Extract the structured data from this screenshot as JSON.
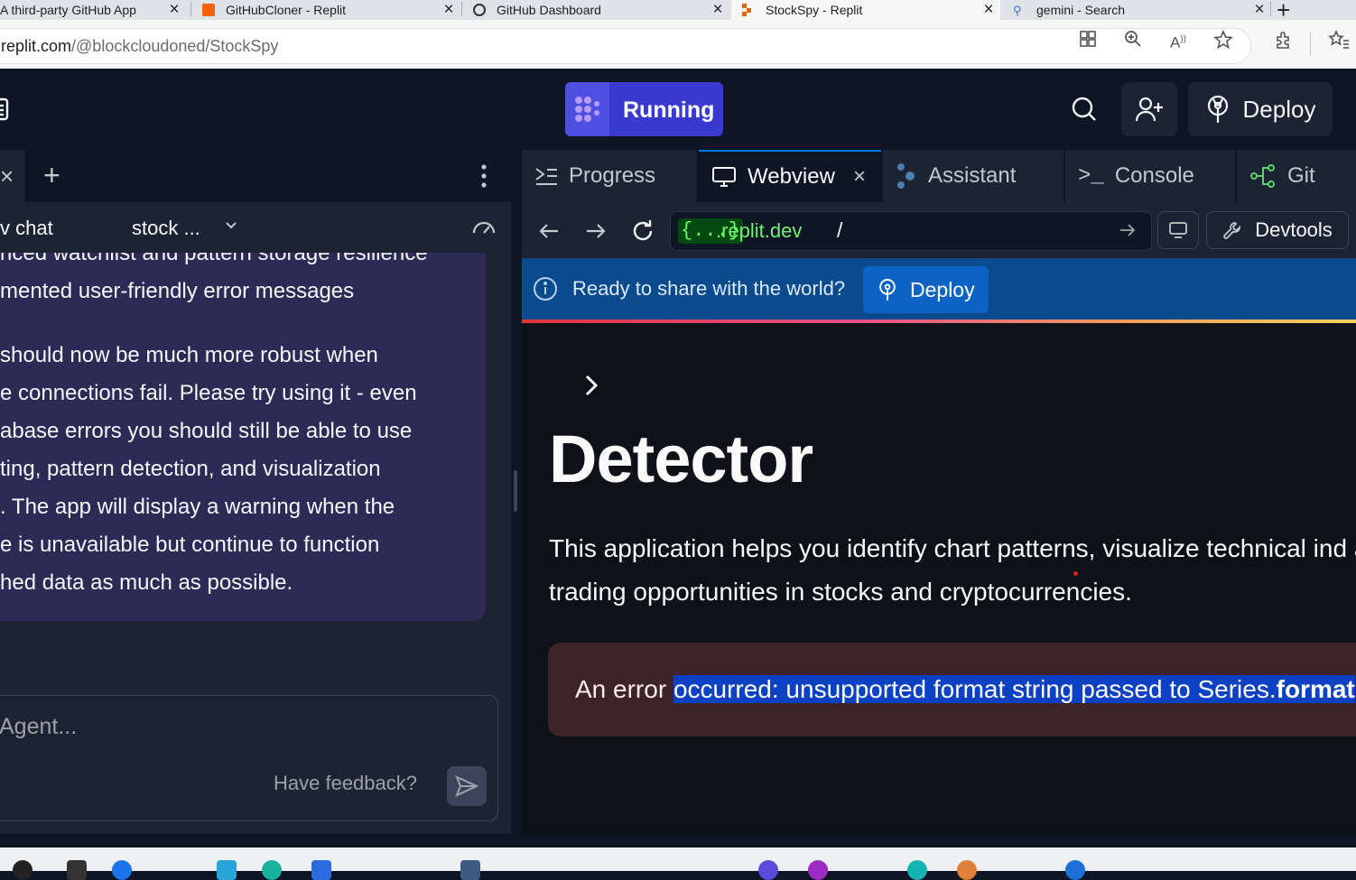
{
  "browser": {
    "tabs": [
      {
        "title": "A third-party GitHub App",
        "prefix": ")]",
        "active": false
      },
      {
        "title": "GitHubCloner - Replit",
        "active": false
      },
      {
        "title": "GitHub Dashboard",
        "active": false
      },
      {
        "title": "StockSpy - Replit",
        "active": true
      },
      {
        "title": "gemini - Search",
        "active": false
      }
    ],
    "url_host": "replit.com",
    "url_path": "/@blockcloudoned/StockSpy"
  },
  "header": {
    "run_label": "Running",
    "deploy_label": "Deploy",
    "colors": {
      "run": "#3b3ad0",
      "bg": "#0e1525"
    }
  },
  "left": {
    "chat_title": "v chat",
    "session": "stock ...",
    "message_lines": [
      "nced watchlist and pattern storage resilience",
      "mented user-friendly error messages",
      "",
      "should now be much more robust when",
      "e connections fail. Please try using it - even",
      "abase errors you should still be able to use",
      "ting, pattern detection, and visualization",
      ". The app will display a warning when the",
      "e is unavailable but continue to function",
      "hed data as much as possible."
    ],
    "input_placeholder": "Agent...",
    "feedback": "Have feedback?"
  },
  "right": {
    "tabs": [
      {
        "label": "Progress",
        "icon": "progress-icon"
      },
      {
        "label": "Webview",
        "icon": "monitor-icon",
        "active": true
      },
      {
        "label": "Assistant",
        "icon": "assistant-icon"
      },
      {
        "label": "Console",
        "icon": "console-icon"
      },
      {
        "label": "Git",
        "icon": "git-icon"
      }
    ],
    "webview": {
      "url_tag": "{...}",
      "url_host": ".replit.dev",
      "url_path": "/",
      "devtools": "Devtools"
    },
    "banner": {
      "text": "Ready to share with the world?",
      "deploy": "Deploy"
    },
    "app": {
      "heading": "Detector",
      "description": "This application helps you identify chart patterns, visualize technical ind and analyze trading opportunities in stocks and cryptocurrencies.",
      "error_prefix": "An error ",
      "error_highlight": "occurred: unsupported format string passed to Series.",
      "error_bold": "format"
    }
  }
}
